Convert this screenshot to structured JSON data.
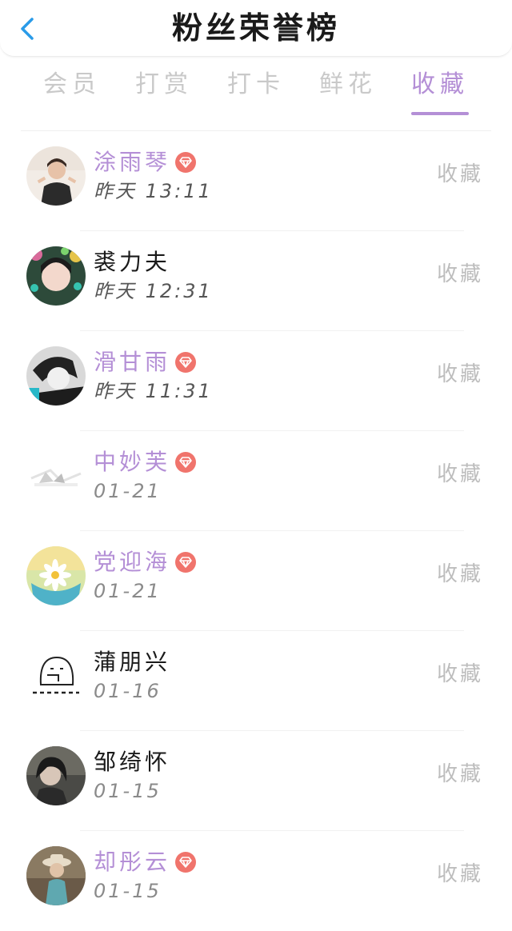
{
  "header": {
    "title": "粉丝荣誉榜",
    "back_icon": "chevron-left-icon",
    "back_color": "#2a9be8"
  },
  "tabs": [
    {
      "label": "会员",
      "active": false
    },
    {
      "label": "打赏",
      "active": false
    },
    {
      "label": "打卡",
      "active": false
    },
    {
      "label": "鲜花",
      "active": false
    },
    {
      "label": "收藏",
      "active": true
    }
  ],
  "colors": {
    "accent": "#b48fd6",
    "vip_badge": "#f0746c",
    "inactive_tab": "#c9c9c9",
    "action_text": "#bdbdbd"
  },
  "fans": [
    {
      "name": "涂雨琴",
      "vip": true,
      "time": "昨天 13:11",
      "action": "收藏",
      "avatar": "avatar-photo-girl"
    },
    {
      "name": "裘力夫",
      "vip": false,
      "time": "昨天 12:31",
      "action": "收藏",
      "avatar": "avatar-photo-girl-flowers"
    },
    {
      "name": "滑甘雨",
      "vip": true,
      "time": "昨天 11:31",
      "action": "收藏",
      "avatar": "avatar-photo-bw"
    },
    {
      "name": "中妙芙",
      "vip": true,
      "time": "01-21",
      "action": "收藏",
      "avatar": "avatar-photo-sketch"
    },
    {
      "name": "党迎海",
      "vip": true,
      "time": "01-21",
      "action": "收藏",
      "avatar": "avatar-photo-daisy"
    },
    {
      "name": "蒲朋兴",
      "vip": false,
      "time": "01-16",
      "action": "收藏",
      "avatar": "avatar-cartoon"
    },
    {
      "name": "邹绮怀",
      "vip": false,
      "time": "01-15",
      "action": "收藏",
      "avatar": "avatar-photo-dark"
    },
    {
      "name": "却彤云",
      "vip": true,
      "time": "01-15",
      "action": "收藏",
      "avatar": "avatar-photo-hat"
    }
  ]
}
